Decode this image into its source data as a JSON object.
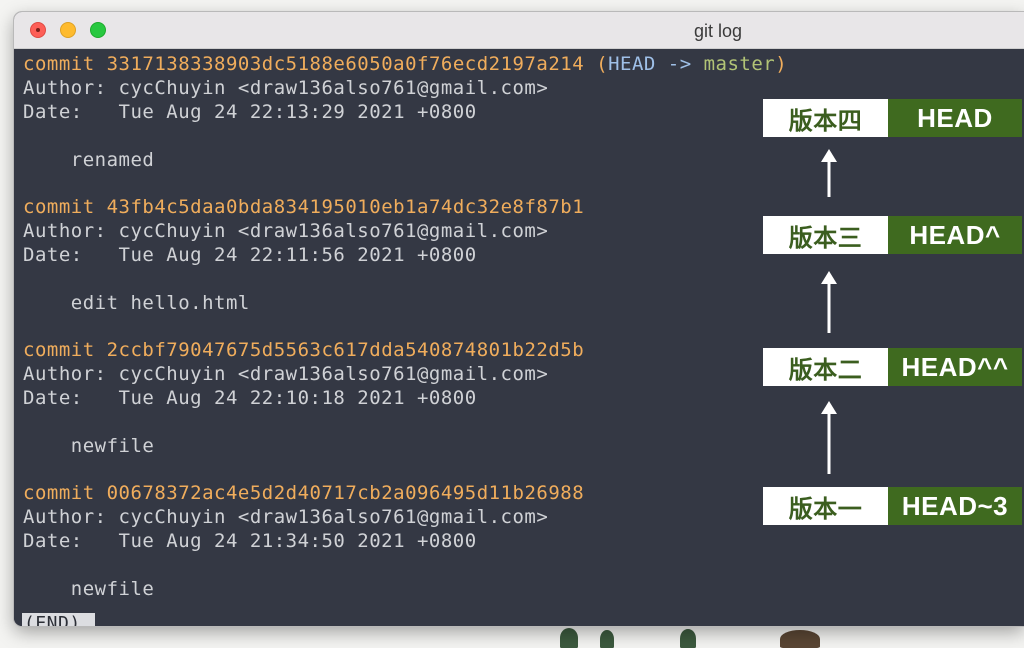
{
  "window": {
    "title": "git log"
  },
  "commits": [
    {
      "commit_label": "commit",
      "hash": "3317138338903dc5188e6050a0f76ecd2197a214",
      "ref_open": "(",
      "ref_head": "HEAD ->",
      "ref_branch": "master",
      "ref_close": ")",
      "author_line": "Author: cycChuyin <draw136also761@gmail.com>",
      "date_line": "Date:   Tue Aug 24 22:13:29 2021 +0800",
      "message": "    renamed"
    },
    {
      "commit_label": "commit",
      "hash": "43fb4c5daa0bda834195010eb1a74dc32e8f87b1",
      "author_line": "Author: cycChuyin <draw136also761@gmail.com>",
      "date_line": "Date:   Tue Aug 24 22:11:56 2021 +0800",
      "message": "    edit hello.html"
    },
    {
      "commit_label": "commit",
      "hash": "2ccbf79047675d5563c617dda540874801b22d5b",
      "author_line": "Author: cycChuyin <draw136also761@gmail.com>",
      "date_line": "Date:   Tue Aug 24 22:10:18 2021 +0800",
      "message": "    newfile"
    },
    {
      "commit_label": "commit",
      "hash": "00678372ac4e5d2d40717cb2a096495d11b26988",
      "author_line": "Author: cycChuyin <draw136also761@gmail.com>",
      "date_line": "Date:   Tue Aug 24 21:34:50 2021 +0800",
      "message": "    newfile"
    }
  ],
  "pager": {
    "end_marker": "(END)"
  },
  "annotations": [
    {
      "version": "版本四",
      "ref": "HEAD"
    },
    {
      "version": "版本三",
      "ref": "HEAD^"
    },
    {
      "version": "版本二",
      "ref": "HEAD^^"
    },
    {
      "version": "版本一",
      "ref": "HEAD~3"
    }
  ],
  "colors": {
    "terminal_bg": "#343844",
    "commit_text": "#f0ad5c",
    "head_ref": "#9fc0e8",
    "branch_ref": "#b2c476",
    "annotation_green": "#3f6a1f",
    "annotation_text_green": "#3b5e1f",
    "arrow": "#ffffff"
  },
  "icons": {
    "close": "close-dot-icon",
    "minimize": "minimize-dot-icon",
    "maximize": "maximize-dot-icon",
    "arrow": "arrow-up-icon"
  }
}
